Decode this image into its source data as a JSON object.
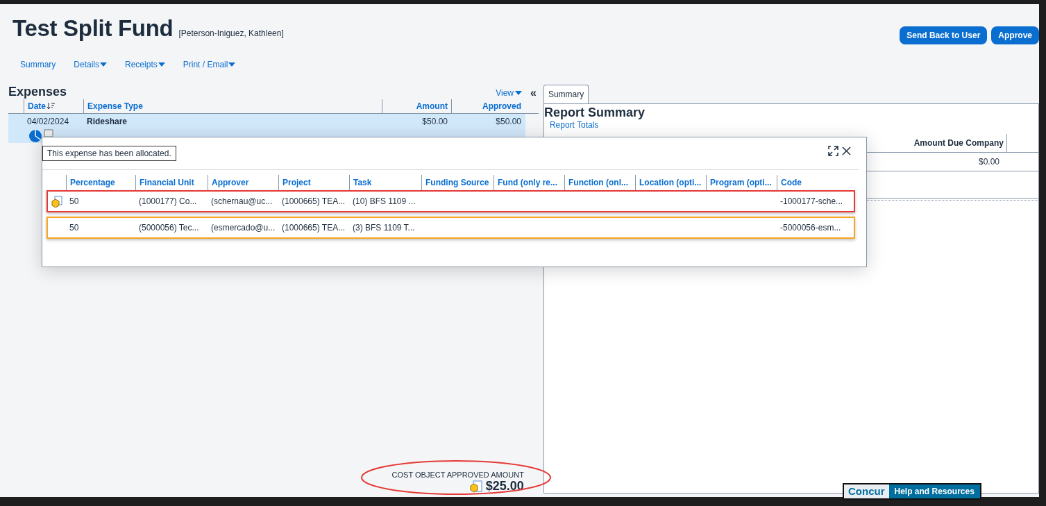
{
  "header": {
    "title": "Test Split Fund",
    "employee": "[Peterson-Iniguez, Kathleen]",
    "buttons": [
      "Send Back to User",
      "Approve"
    ]
  },
  "nav": [
    {
      "label": "Summary",
      "dropdown": false
    },
    {
      "label": "Details",
      "dropdown": true
    },
    {
      "label": "Receipts",
      "dropdown": true
    },
    {
      "label": "Print / Email",
      "dropdown": true
    }
  ],
  "expenses": {
    "title": "Expenses",
    "view": "View",
    "collapse": "«",
    "columns": [
      "Date",
      "Expense Type",
      "Amount",
      "Approved"
    ],
    "rows": [
      {
        "date": "04/02/2024",
        "type": "Rideshare",
        "amount": "$50.00",
        "approved": "$50.00",
        "selected": true,
        "allocated": true
      }
    ]
  },
  "cost_object": {
    "label": "COST OBJECT APPROVED AMOUNT",
    "amount": "$25.00"
  },
  "right_panel": {
    "tabs": [
      {
        "label": "Summary",
        "selected": true
      }
    ],
    "title": "Report Summary",
    "link": "Report Totals",
    "column": "Amount Due Company",
    "value": "$0.00"
  },
  "allocation_popup": {
    "tooltip": "This expense has been allocated.",
    "columns": [
      "Percentage",
      "Financial Unit",
      "Approver",
      "Project",
      "Task",
      "Funding Source",
      "Fund (only re...",
      "Function (onl...",
      "Location (opti...",
      "Program (opti...",
      "Code"
    ],
    "rows": [
      {
        "color": "#e53935",
        "cost_object": true,
        "cells": [
          "50",
          "(1000177) Co...",
          "(schernau@uc...",
          "(1000665) TEA...",
          "(10) BFS 1109 ...",
          "",
          "",
          "",
          "",
          "",
          "-1000177-sche..."
        ]
      },
      {
        "color": "#f5a623",
        "cost_object": false,
        "cells": [
          "50",
          "(5000056) Tec...",
          "(esmercado@u...",
          "(1000665) TEA...",
          "(3) BFS 1109 T...",
          "",
          "",
          "",
          "",
          "",
          "-5000056-esm..."
        ]
      }
    ]
  },
  "help_badge": {
    "brand": "Concur",
    "label": "Help and Resources"
  }
}
